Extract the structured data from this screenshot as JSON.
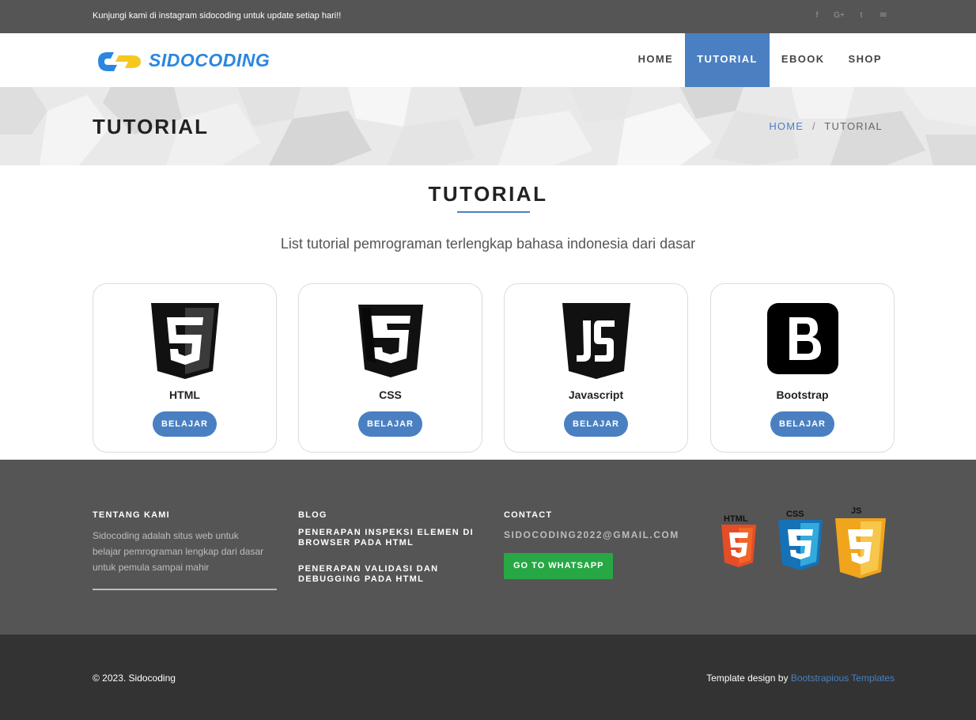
{
  "topbar": {
    "message": "Kunjungi kami di instagram sidocoding untuk update setiap hari!!",
    "social_icons": [
      "facebook-icon",
      "google-plus-icon",
      "twitter-icon",
      "email-icon"
    ]
  },
  "brand": {
    "name": "SIDOCODING",
    "colors": {
      "blue": "#2a86e0",
      "yellow": "#f4c81f"
    }
  },
  "nav": {
    "items": [
      {
        "label": "HOME",
        "active": false
      },
      {
        "label": "TUTORIAL",
        "active": true
      },
      {
        "label": "EBOOK",
        "active": false
      },
      {
        "label": "SHOP",
        "active": false
      }
    ]
  },
  "page_header": {
    "title": "TUTORIAL",
    "breadcrumb": {
      "home": "HOME",
      "separator": "/",
      "current": "TUTORIAL"
    }
  },
  "main": {
    "title": "TUTORIAL",
    "subtitle": "List tutorial pemrograman terlengkap bahasa indonesia dari dasar",
    "cards": [
      {
        "name": "HTML",
        "icon": "html5-icon",
        "button": "BELAJAR"
      },
      {
        "name": "CSS",
        "icon": "css3-icon",
        "button": "BELAJAR"
      },
      {
        "name": "Javascript",
        "icon": "javascript-icon",
        "button": "BELAJAR"
      },
      {
        "name": "Bootstrap",
        "icon": "bootstrap-icon",
        "button": "BELAJAR"
      }
    ]
  },
  "footer": {
    "about": {
      "heading": "TENTANG KAMI",
      "text": "Sidocoding adalah situs web untuk belajar pemrograman lengkap dari dasar untuk pemula sampai mahir"
    },
    "blog": {
      "heading": "BLOG",
      "posts": [
        "PENERAPAN INSPEKSI ELEMEN DI BROWSER PADA HTML",
        "PENERAPAN VALIDASI DAN DEBUGGING PADA HTML"
      ]
    },
    "contact": {
      "heading": "CONTACT",
      "email": "SIDOCODING2022@GMAIL.COM",
      "button": "GO TO WHATSAPP"
    },
    "badges": {
      "html_label": "HTML",
      "css_label": "CSS",
      "js_label": "JS",
      "colors": {
        "html": "#e44d26",
        "css": "#1572b6",
        "js": "#f0a51d"
      }
    }
  },
  "bottom": {
    "copyright": "© 2023. Sidocoding",
    "credit_prefix": "Template design by ",
    "credit_link": "Bootstrapious Templates"
  },
  "colors": {
    "accent": "#4a80c2",
    "topbar": "#555555",
    "footer_dark": "#333333",
    "whatsapp": "#28a745"
  }
}
